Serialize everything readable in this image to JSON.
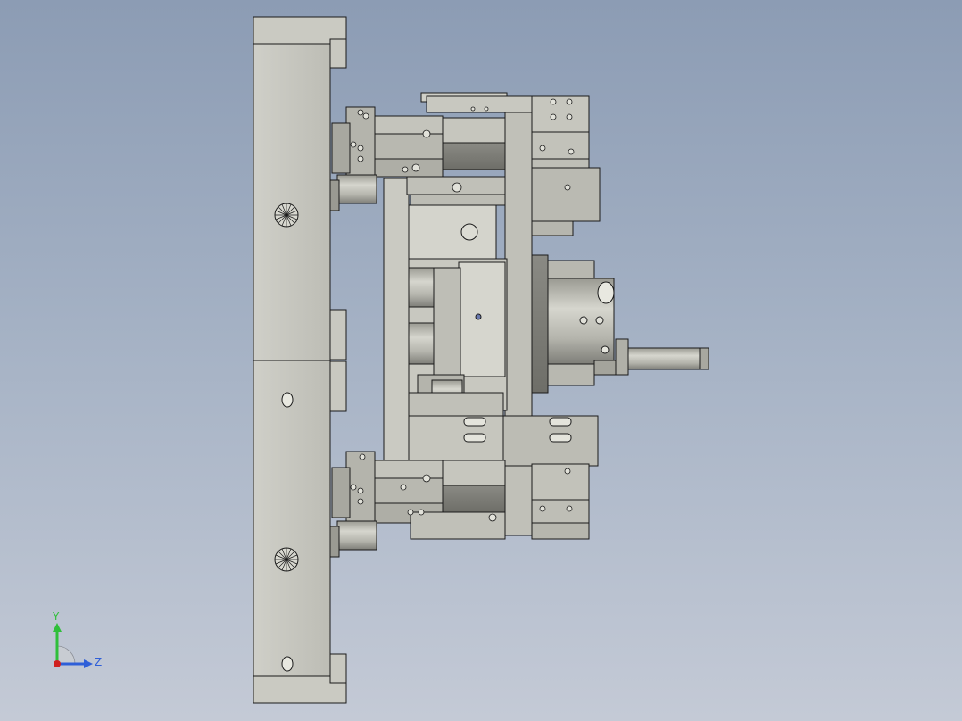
{
  "viewport": {
    "background_top": "#8c9cb4",
    "background_bottom": "#c4cad6"
  },
  "model": {
    "part_fill": "#c4c4bc",
    "part_light": "#d8d8d0",
    "part_dark": "#8a8a84",
    "edge_color": "#1a1a1a"
  },
  "triad": {
    "y_label": "Y",
    "z_label": "Z",
    "y_color": "#2fbf3a",
    "z_color": "#2f5fd8",
    "origin_color": "#d02020"
  }
}
